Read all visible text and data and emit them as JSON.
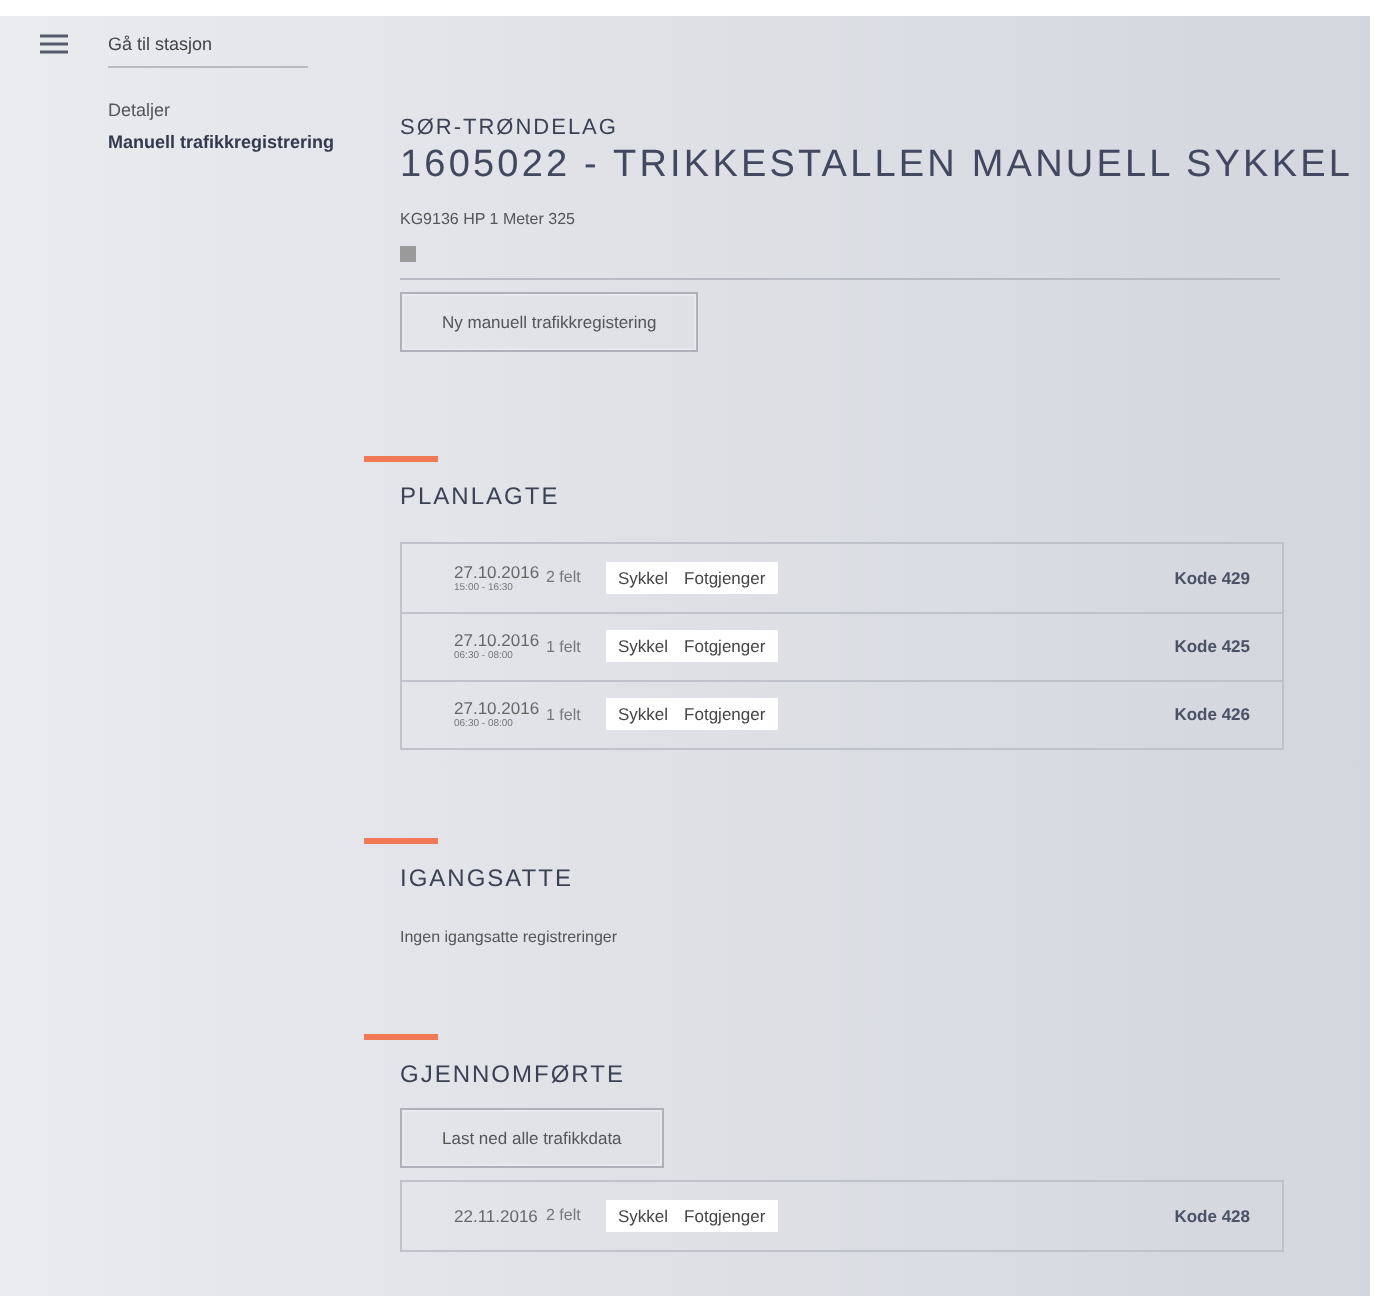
{
  "nav": {
    "search_link": "Gå til stasjon",
    "items": [
      {
        "label": "Detaljer",
        "selected": false
      },
      {
        "label": "Manuell trafikkregistrering",
        "selected": true
      }
    ]
  },
  "header": {
    "county": "SØR-TRØNDELAG",
    "title": "1605022 - TRIKKESTALLEN MANUELL SYKKEL",
    "subtitle": "KG9136 HP 1 Meter 325",
    "button": "Ny manuell trafikkregistering"
  },
  "sections": [
    {
      "heading": "PLANLAGTE",
      "rows": [
        {
          "date": "27.10.2016",
          "time": "15:00 - 16:30",
          "lanes": "2 felt",
          "tags": [
            "Sykkel",
            "Fotgjenger"
          ],
          "code": "Kode 429"
        },
        {
          "date": "27.10.2016",
          "time": "06:30 - 08:00",
          "lanes": "1 felt",
          "tags": [
            "Sykkel",
            "Fotgjenger"
          ],
          "code": "Kode 425"
        },
        {
          "date": "27.10.2016",
          "time": "06:30 - 08:00",
          "lanes": "1 felt",
          "tags": [
            "Sykkel",
            "Fotgjenger"
          ],
          "code": "Kode 426"
        }
      ]
    },
    {
      "heading": "IGANGSATTE",
      "empty_text": "Ingen igangsatte registreringer"
    },
    {
      "heading": "GJENNOMFØRTE",
      "button": "Last ned alle trafikkdata",
      "rows": [
        {
          "date": "22.11.2016",
          "lanes": "2 felt",
          "tags": [
            "Sykkel",
            "Fotgjenger"
          ],
          "code": "Kode 428"
        }
      ]
    }
  ]
}
